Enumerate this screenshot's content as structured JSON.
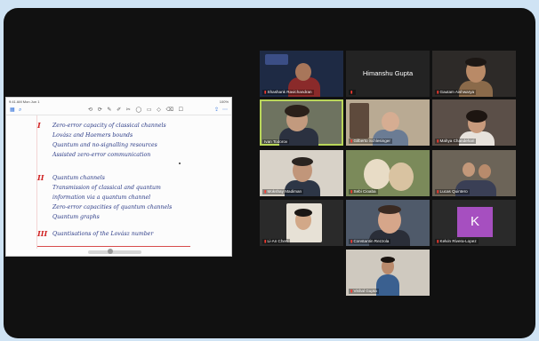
{
  "shared_screen": {
    "status_left": "9:41 AM Mon Jun 1",
    "status_right": "100%",
    "toolbar_tools": "⟲ ⟳ ✎ ✐ ✂ ◯ ▭ ◇ ⌫ ☐",
    "notes": [
      {
        "bullet": "I",
        "lines": [
          "Zero-error capacity of classical channels",
          "Lovász and Haemers bounds",
          "Quantum and no-signalling resources",
          "Assisted zero-error communication"
        ]
      },
      {
        "bullet": "II",
        "lines": [
          "Quantum channels",
          "Transmission of classical and quantum",
          "information via a quantum channel",
          "Zero-error capacities of quantum channels",
          "Quantum graphs"
        ]
      },
      {
        "bullet": "III",
        "lines": [
          "Quantisations of the Lovász number"
        ]
      }
    ]
  },
  "participants": [
    {
      "name": "Shashank Ravichandran",
      "tile": "photo"
    },
    {
      "name": "Himanshu Gupta",
      "tile": "name-only"
    },
    {
      "name": "Gautam Aishwarya",
      "tile": "photo"
    },
    {
      "name": "Ivan Todorov",
      "tile": "photo",
      "active": true
    },
    {
      "name": "Gilberto Schlesinger",
      "tile": "photo"
    },
    {
      "name": "Mahya Chandehari",
      "tile": "photo"
    },
    {
      "name": "Mokshay Madiman",
      "tile": "photo"
    },
    {
      "name": "Sebi Cioaba",
      "tile": "photo"
    },
    {
      "name": "Lucas Quintero",
      "tile": "photo"
    },
    {
      "name": "Li-An Chen",
      "tile": "photo"
    },
    {
      "name": "Constantin Rezzola",
      "tile": "photo"
    },
    {
      "name": "Kelvin Rivera-Lopez",
      "tile": "initial",
      "initial": "K"
    },
    {
      "name": "Vishal Gupta",
      "tile": "photo"
    }
  ],
  "colors": {
    "active_outline": "#b9d65a",
    "muted_mic": "#ff3b30",
    "avatar_k": "#a64fc0",
    "ink": "#2a3a86",
    "ink_red": "#d02020"
  }
}
